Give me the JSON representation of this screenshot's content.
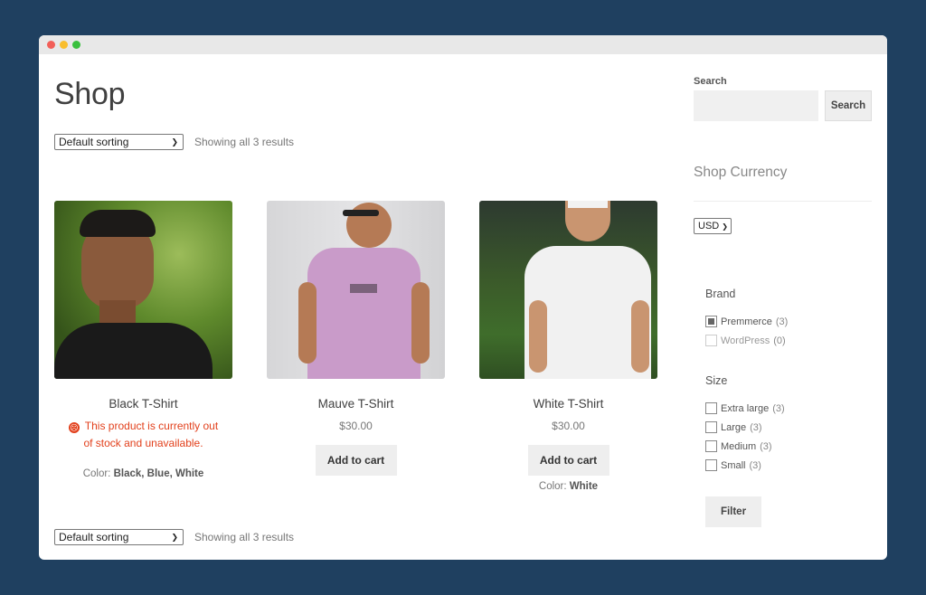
{
  "window": {
    "controls": [
      "close",
      "minimize",
      "maximize"
    ]
  },
  "page": {
    "title": "Shop",
    "sorting": {
      "selected": "Default sorting"
    },
    "result_count": "Showing all 3 results"
  },
  "products": [
    {
      "name": "Black T-Shirt",
      "image_alt": "Man wearing black t-shirt in front of green leaves",
      "stock_message": "This product is currently out of stock and unavailable.",
      "color_label": "Color:",
      "color_values": "Black, Blue, White"
    },
    {
      "name": "Mauve T-Shirt",
      "image_alt": "Man wearing mauve t-shirt with sunglasses",
      "price": "$30.00",
      "button": "Add to cart"
    },
    {
      "name": "White T-Shirt",
      "image_alt": "Man wearing white t-shirt outdoors",
      "price": "$30.00",
      "button": "Add to cart",
      "color_label": "Color:",
      "color_values": "White"
    }
  ],
  "sidebar": {
    "search": {
      "label": "Search",
      "value": "",
      "button": "Search"
    },
    "currency": {
      "title": "Shop Currency",
      "selected": "USD"
    },
    "brand": {
      "title": "Brand",
      "items": [
        {
          "label": "Premmerce",
          "count": "(3)",
          "checked": true
        },
        {
          "label": "WordPress",
          "count": "(0)",
          "checked": false,
          "disabled": true
        }
      ]
    },
    "size": {
      "title": "Size",
      "items": [
        {
          "label": "Extra large",
          "count": "(3)"
        },
        {
          "label": "Large",
          "count": "(3)"
        },
        {
          "label": "Medium",
          "count": "(3)"
        },
        {
          "label": "Small",
          "count": "(3)"
        }
      ]
    },
    "filter_button": "Filter"
  },
  "colors": {
    "background": "#1f4060",
    "error": "#e2401c",
    "button_bg": "#eeeeee"
  }
}
